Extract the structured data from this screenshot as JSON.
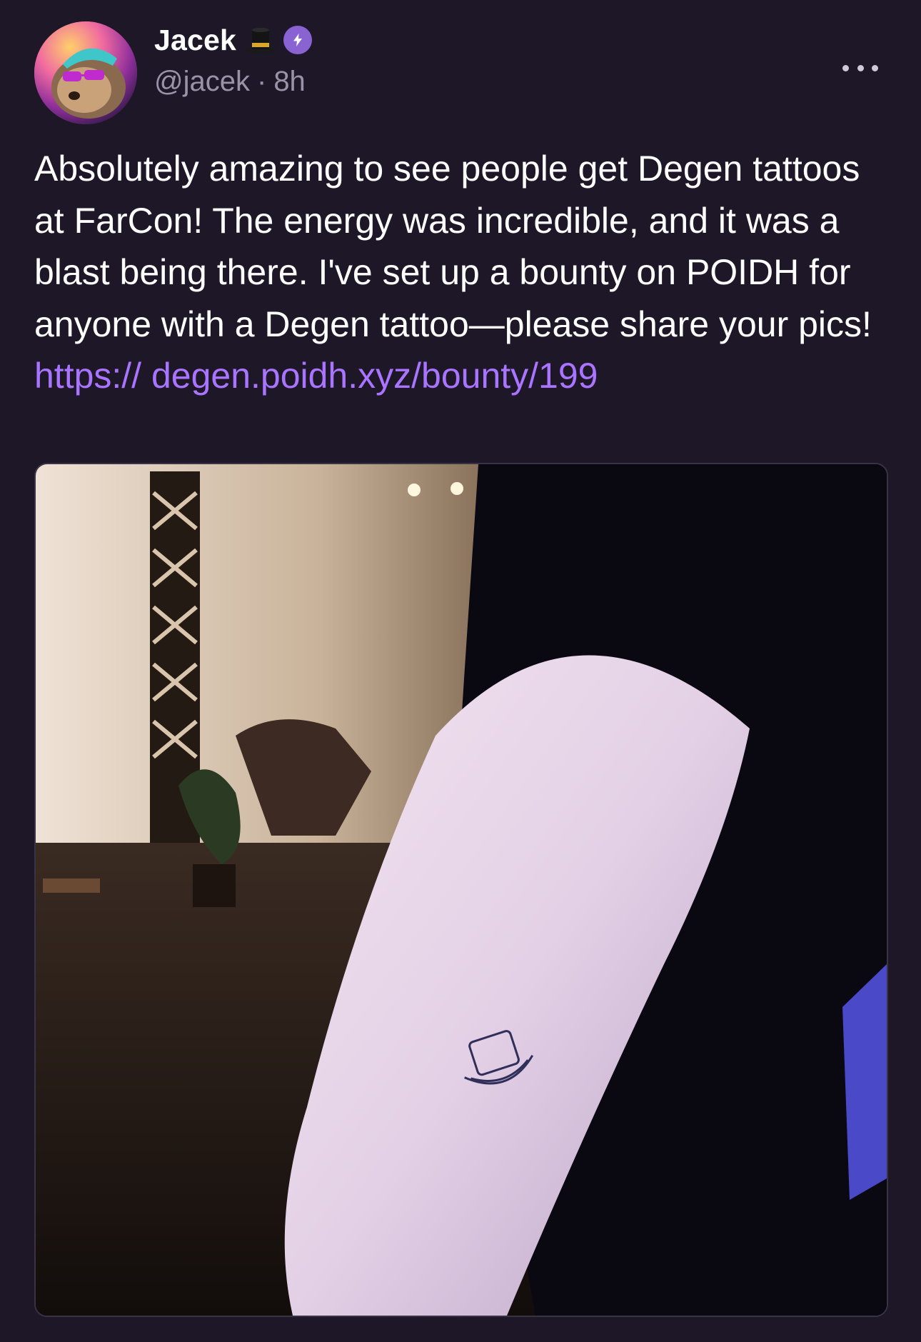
{
  "cast": {
    "author": {
      "display_name": "Jacek",
      "name_emoji": "top-hat-emoji",
      "badge": "power-badge-icon",
      "handle": "@jacek",
      "separator": "·",
      "timestamp": "8h"
    },
    "text": "Absolutely amazing to see people get Degen tattoos at FarCon! The energy was incredible, and it was a blast being there. I've set up a bounty on POIDH for anyone with a Degen tattoo—please share your pics! ",
    "link_text": "https:// degen.poidh.xyz/bounty/199",
    "more_icon": "more-horizontal-icon",
    "embed_image": "tattoo-photo"
  },
  "colors": {
    "background": "#1e1727",
    "link": "#a974ff",
    "badge": "#8a63d2",
    "muted_text": "#9a93a8"
  }
}
